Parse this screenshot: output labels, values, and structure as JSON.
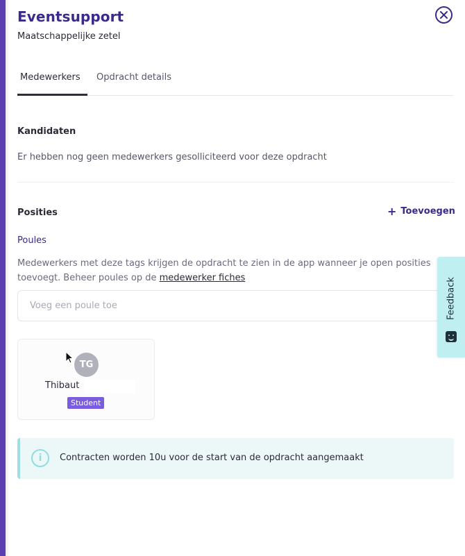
{
  "header": {
    "title": "Eventsupport",
    "subtitle": "Maatschappelijke zetel"
  },
  "tabs": [
    {
      "label": "Medewerkers",
      "active": true
    },
    {
      "label": "Opdracht details",
      "active": false
    }
  ],
  "candidates": {
    "heading": "Kandidaten",
    "empty_text": "Er hebben nog geen medewerkers gesolliciteerd voor deze opdracht"
  },
  "positions": {
    "heading": "Posities",
    "add_label": "Toevoegen",
    "add_icon": "plus-icon"
  },
  "poules": {
    "heading": "Poules",
    "description": "Medewerkers met deze tags krijgen de opdracht te zien in de app wanneer je open posities toevoegt. Beheer poules op de",
    "link_text": "medewerker fiches",
    "input_placeholder": "Voeg een poule toe"
  },
  "workers": [
    {
      "initials": "TG",
      "name": "Thibaut",
      "role": "Student"
    }
  ],
  "info": {
    "icon": "info-icon",
    "text": "Contracten worden 10u voor de start van de opdracht aangemaakt"
  },
  "feedback": {
    "label": "Feedback"
  },
  "colors": {
    "accent": "#3a2a8c",
    "badge": "#7a5ce0",
    "info_bg": "#ecf8f8",
    "info_border": "#9ddfe3",
    "feedback_bg": "#bfeff1"
  }
}
